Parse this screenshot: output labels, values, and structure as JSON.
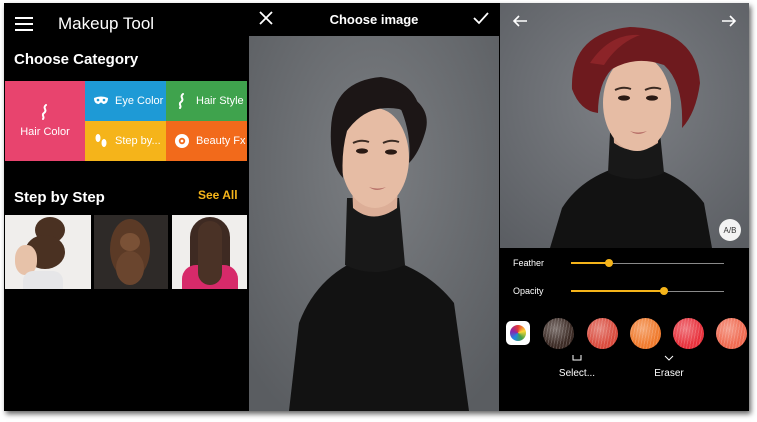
{
  "panel_left": {
    "app_title": "Makeup Tool",
    "choose_category_title": "Choose Category",
    "categories": [
      {
        "label": "Hair Color",
        "icon": "hair-icon",
        "color": "#e8446e"
      },
      {
        "label": "Eye Color",
        "icon": "mask-icon",
        "color": "#1e9ad6"
      },
      {
        "label": "Hair Style",
        "icon": "hair-icon",
        "color": "#3fa34d"
      },
      {
        "label": "Step by...",
        "icon": "footsteps-icon",
        "color": "#f5b41a"
      },
      {
        "label": "Beauty Fx",
        "icon": "effects-icon",
        "color": "#f26a1b"
      }
    ],
    "step_by_step_title": "Step by Step",
    "see_all_label": "See All"
  },
  "panel_middle": {
    "title": "Choose image"
  },
  "panel_right": {
    "ab_label": "A/B",
    "sliders": [
      {
        "label": "Feather",
        "value": 0.25
      },
      {
        "label": "Opacity",
        "value": 0.61
      }
    ],
    "swatch_colors": [
      "#3b2a24",
      "#d94a3c",
      "#f07a2c",
      "#e8313c",
      "#f06a50"
    ],
    "tools": [
      {
        "label": "Select..."
      },
      {
        "label": "Eraser"
      }
    ]
  },
  "colors": {
    "accent": "#f5b41a"
  }
}
